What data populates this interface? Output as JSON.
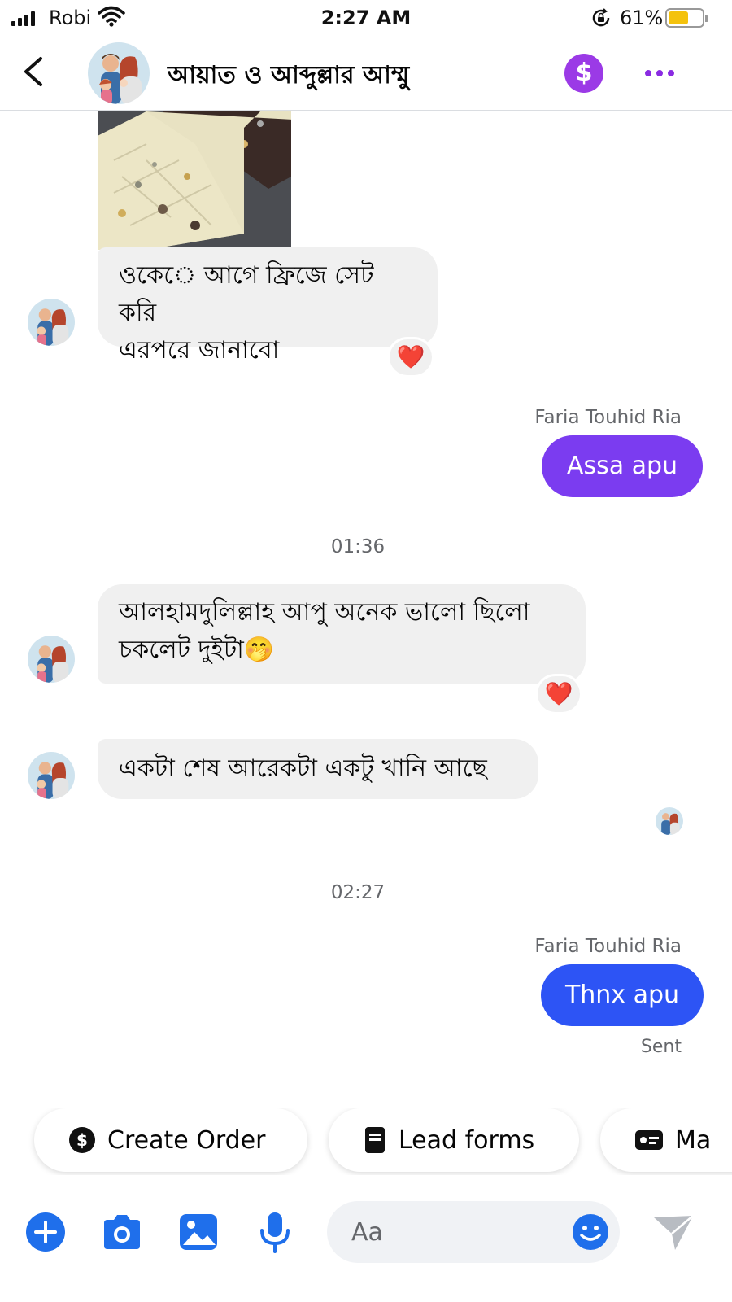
{
  "status_bar": {
    "carrier": "Robi",
    "time": "2:27 AM",
    "battery_percent": "61%",
    "battery_level": 0.61,
    "icons": [
      "signal-icon",
      "wifi-icon",
      "orientation-lock-icon",
      "battery-icon"
    ]
  },
  "header": {
    "title": "আয়াত ও আব্দুল্লার আম্মু",
    "pay_symbol": "$",
    "icons": [
      "back-arrow-icon",
      "payment-icon",
      "more-options-icon"
    ],
    "accent_color": "#9b3ae6"
  },
  "messages": [
    {
      "direction": "incoming",
      "type": "photo",
      "alt_icon": "chocolate-bar-photo"
    },
    {
      "direction": "incoming",
      "lines": [
        "ওকে◌ে আগে ফ্রিজে সেট করি",
        "এরপরে জানাবো"
      ],
      "reaction": "❤️"
    },
    {
      "direction": "outgoing",
      "sender": "Faria Touhid Ria",
      "text": "Assa apu",
      "color": "#7b3cf0"
    },
    {
      "direction": "divider",
      "timestamp": "01:36"
    },
    {
      "direction": "incoming",
      "lines": [
        "আলহামদুলিল্লাহ আপু অনেক ভালো ছিলো",
        "চকলেট দুইটা🤭"
      ],
      "reaction": "❤️"
    },
    {
      "direction": "incoming",
      "lines": [
        "একটা শেষ আরেকটা একটু খানি আছে"
      ]
    },
    {
      "direction": "divider",
      "timestamp": "02:27"
    },
    {
      "direction": "outgoing",
      "sender": "Faria Touhid Ria",
      "text": "Thnx apu",
      "status": "Sent",
      "color": "#2d54f5"
    }
  ],
  "quick_replies": [
    {
      "label": "Create Order",
      "icon": "dollar-circle-icon"
    },
    {
      "label": "Lead forms",
      "icon": "form-icon"
    },
    {
      "label": "Ma",
      "icon": "card-icon"
    }
  ],
  "composer": {
    "placeholder": "Aa",
    "icons": [
      "plus-icon",
      "camera-icon",
      "gallery-icon",
      "microphone-icon",
      "emoji-icon",
      "send-icon"
    ],
    "accent_color": "#1f6feb"
  }
}
